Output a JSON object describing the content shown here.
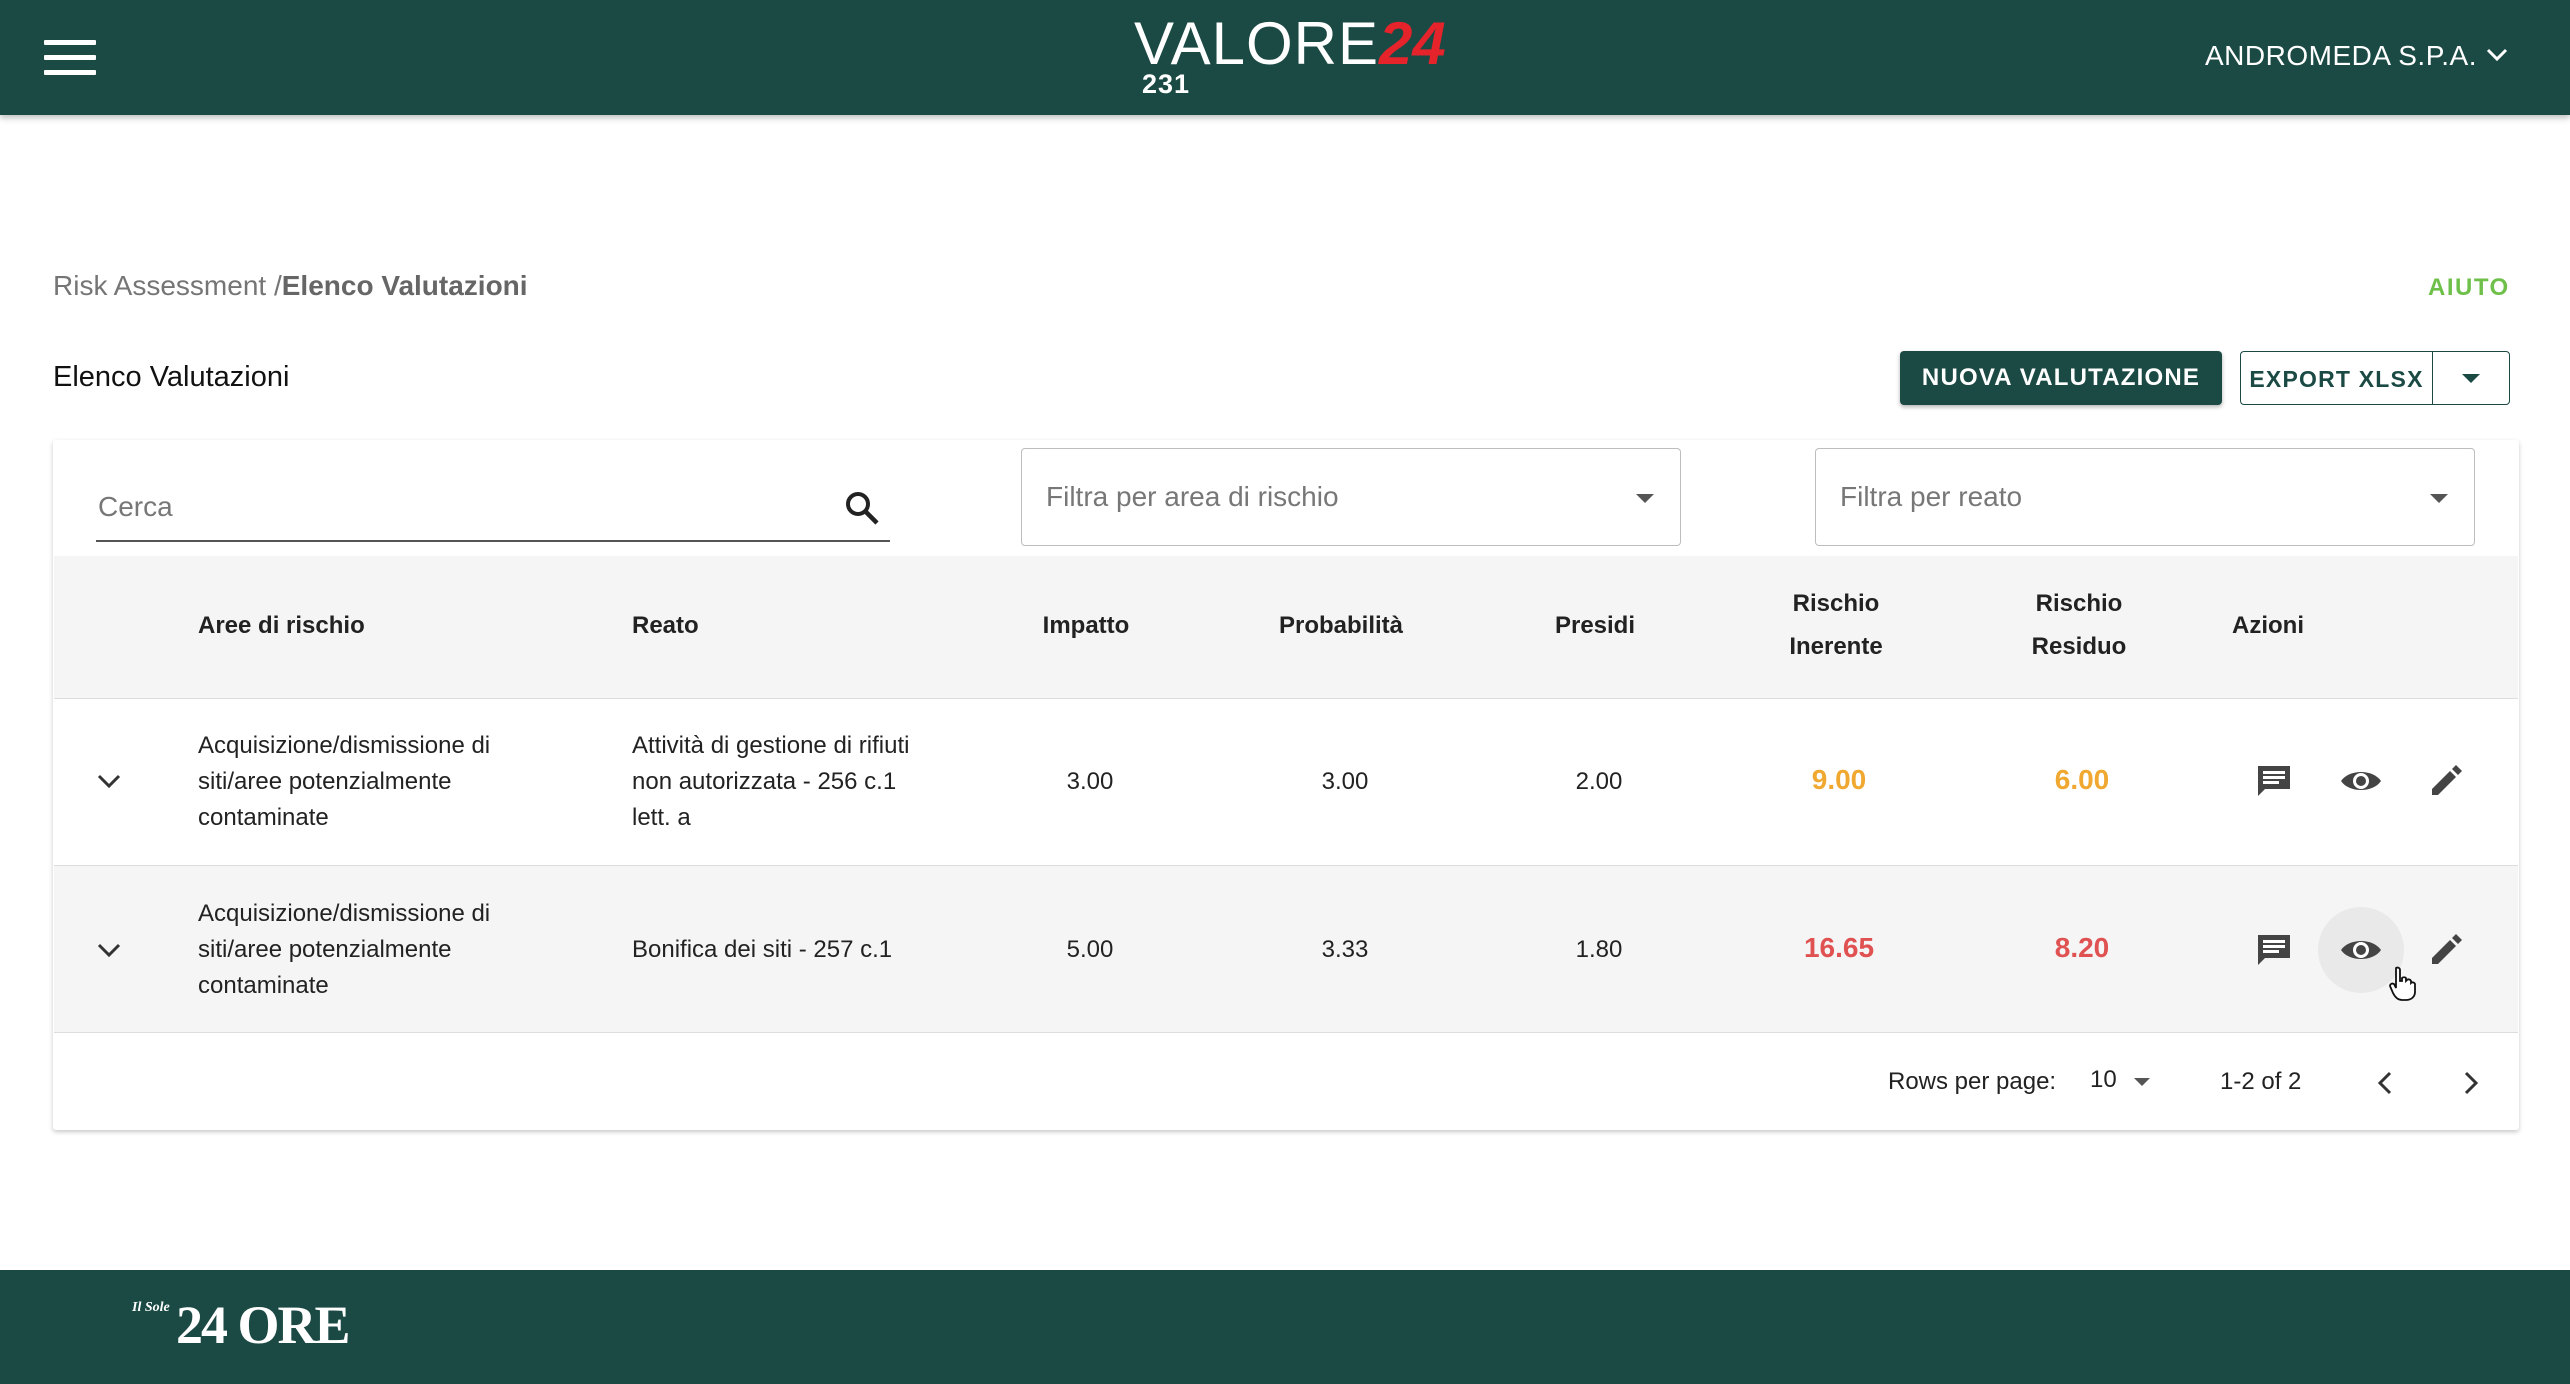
{
  "header": {
    "logo_text": "VALORE",
    "logo_accent": "24",
    "logo_sub": "231",
    "company": "ANDROMEDA S.P.A."
  },
  "breadcrumb": {
    "parent": "Risk Assessment /",
    "current": "Elenco Valutazioni"
  },
  "help_label": "AIUTO",
  "page_title": "Elenco Valutazioni",
  "buttons": {
    "new": "NUOVA VALUTAZIONE",
    "export": "EXPORT XLSX"
  },
  "filters": {
    "search_placeholder": "Cerca",
    "area_placeholder": "Filtra per area di rischio",
    "reato_placeholder": "Filtra per reato"
  },
  "table": {
    "headers": {
      "area": "Aree di rischio",
      "reato": "Reato",
      "impatto": "Impatto",
      "probabilita": "Probabilità",
      "presidi": "Presidi",
      "inerente_1": "Rischio",
      "inerente_2": "Inerente",
      "residuo_1": "Rischio",
      "residuo_2": "Residuo",
      "azioni": "Azioni"
    },
    "rows": [
      {
        "area": [
          "Acquisizione/dismissione di",
          "siti/aree potenzialmente",
          "contaminate"
        ],
        "reato": [
          "Attività di gestione di rifiuti",
          "non autorizzata - 256 c.1",
          "lett. a"
        ],
        "impatto": "3.00",
        "probabilita": "3.00",
        "presidi": "2.00",
        "inerente": "9.00",
        "residuo": "6.00"
      },
      {
        "area": [
          "Acquisizione/dismissione di",
          "siti/aree potenzialmente",
          "contaminate"
        ],
        "reato": [
          "Bonifica dei siti - 257 c.1"
        ],
        "impatto": "5.00",
        "probabilita": "3.33",
        "presidi": "1.80",
        "inerente": "16.65",
        "residuo": "8.20"
      }
    ]
  },
  "pagination": {
    "rows_per_page_label": "Rows per page:",
    "rows_per_page": "10",
    "range": "1-2 of 2"
  },
  "footer": {
    "brand_small": "Il Sole",
    "brand_big": "24 ORE"
  },
  "colors": {
    "primary": "#1b4a44",
    "accent_red": "#e4232b",
    "help_green": "#6fc04a",
    "risk_orange": "#f0a830",
    "risk_red": "#e05252"
  }
}
